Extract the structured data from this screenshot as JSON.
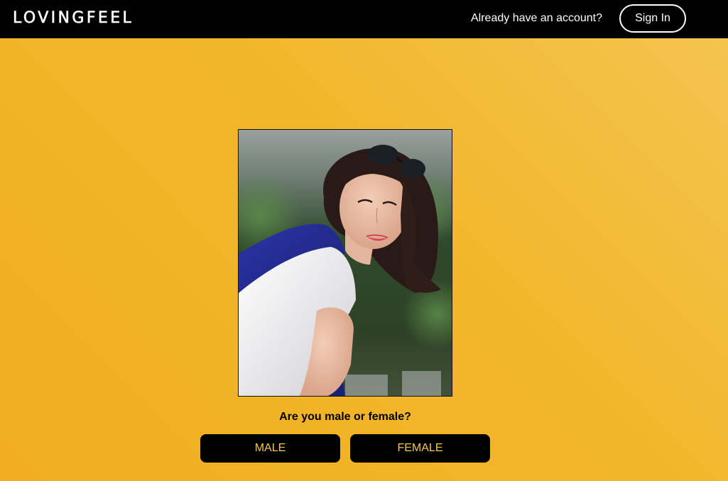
{
  "header": {
    "logo": "LOVINGFEEL",
    "already_text": "Already have an account?",
    "signin_label": "Sign In"
  },
  "main": {
    "photo_icon": "profile-photo",
    "question": "Are you male or female?",
    "options": {
      "male": "MALE",
      "female": "FEMALE"
    }
  },
  "colors": {
    "header_bg": "#000000",
    "page_bg": "#f2b62a",
    "button_bg": "#000000",
    "button_text": "#f5c84c"
  }
}
